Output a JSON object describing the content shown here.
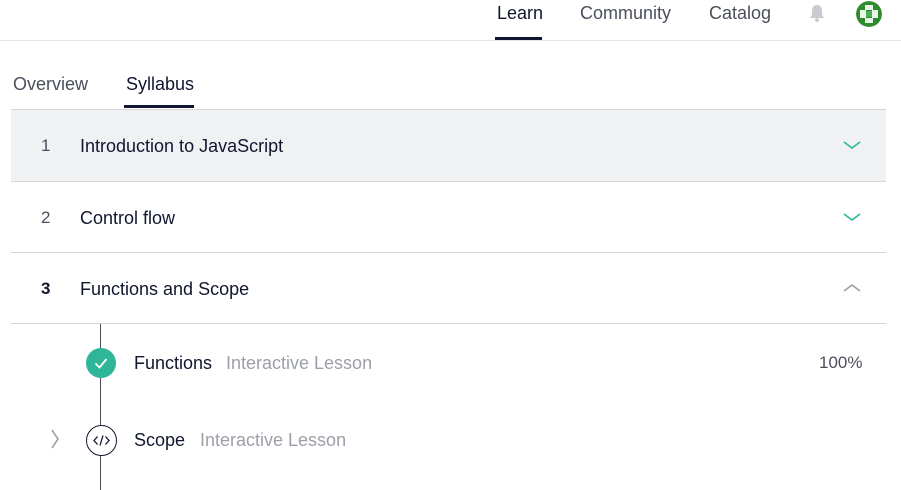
{
  "nav": {
    "learn": "Learn",
    "community": "Community",
    "catalog": "Catalog",
    "bell_icon": "bell-icon",
    "avatar_icon": "avatar-icon"
  },
  "tabs": {
    "overview": "Overview",
    "syllabus": "Syllabus"
  },
  "modules": [
    {
      "number": "1",
      "title": "Introduction to JavaScript",
      "state": "collapsed"
    },
    {
      "number": "2",
      "title": "Control flow",
      "state": "collapsed"
    },
    {
      "number": "3",
      "title": "Functions and Scope",
      "state": "expanded"
    }
  ],
  "lessons": [
    {
      "name": "Functions",
      "type": "Interactive Lesson",
      "progress": "100%",
      "status": "completed",
      "icon": "check-icon"
    },
    {
      "name": "Scope",
      "type": "Interactive Lesson",
      "status": "not-started",
      "icon": "code-icon"
    }
  ],
  "colors": {
    "accent_teal": "#2fb597",
    "navy": "#10162f",
    "muted_text": "#9c9fa8",
    "selected_row_bg": "#f0f1f2"
  }
}
